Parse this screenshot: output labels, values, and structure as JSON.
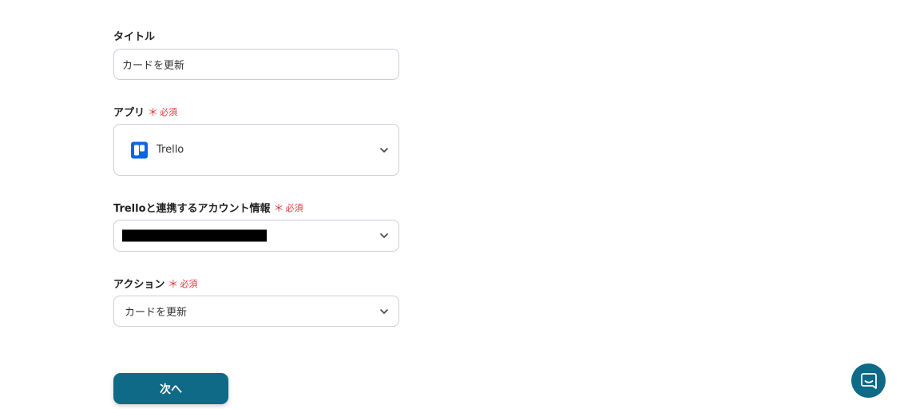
{
  "form": {
    "title": {
      "label": "タイトル",
      "value": "カードを更新"
    },
    "app": {
      "label": "アプリ",
      "required_mark": "＊",
      "required_text": "必須",
      "selected_value": "Trello",
      "icon": "trello-logo-icon"
    },
    "account": {
      "label": "Trelloと連携するアカウント情報",
      "required_mark": "＊",
      "required_text": "必須",
      "value_redacted": true
    },
    "action": {
      "label": "アクション",
      "required_mark": "＊",
      "required_text": "必須",
      "selected_value": "カードを更新"
    }
  },
  "next_button": {
    "label": "次へ"
  },
  "chat_button": {
    "icon": "chat-icon"
  },
  "colors": {
    "primary": "#0e6a86",
    "required": "#e2363c",
    "trello_blue": "#0c66e4",
    "border": "#c9ced6"
  }
}
